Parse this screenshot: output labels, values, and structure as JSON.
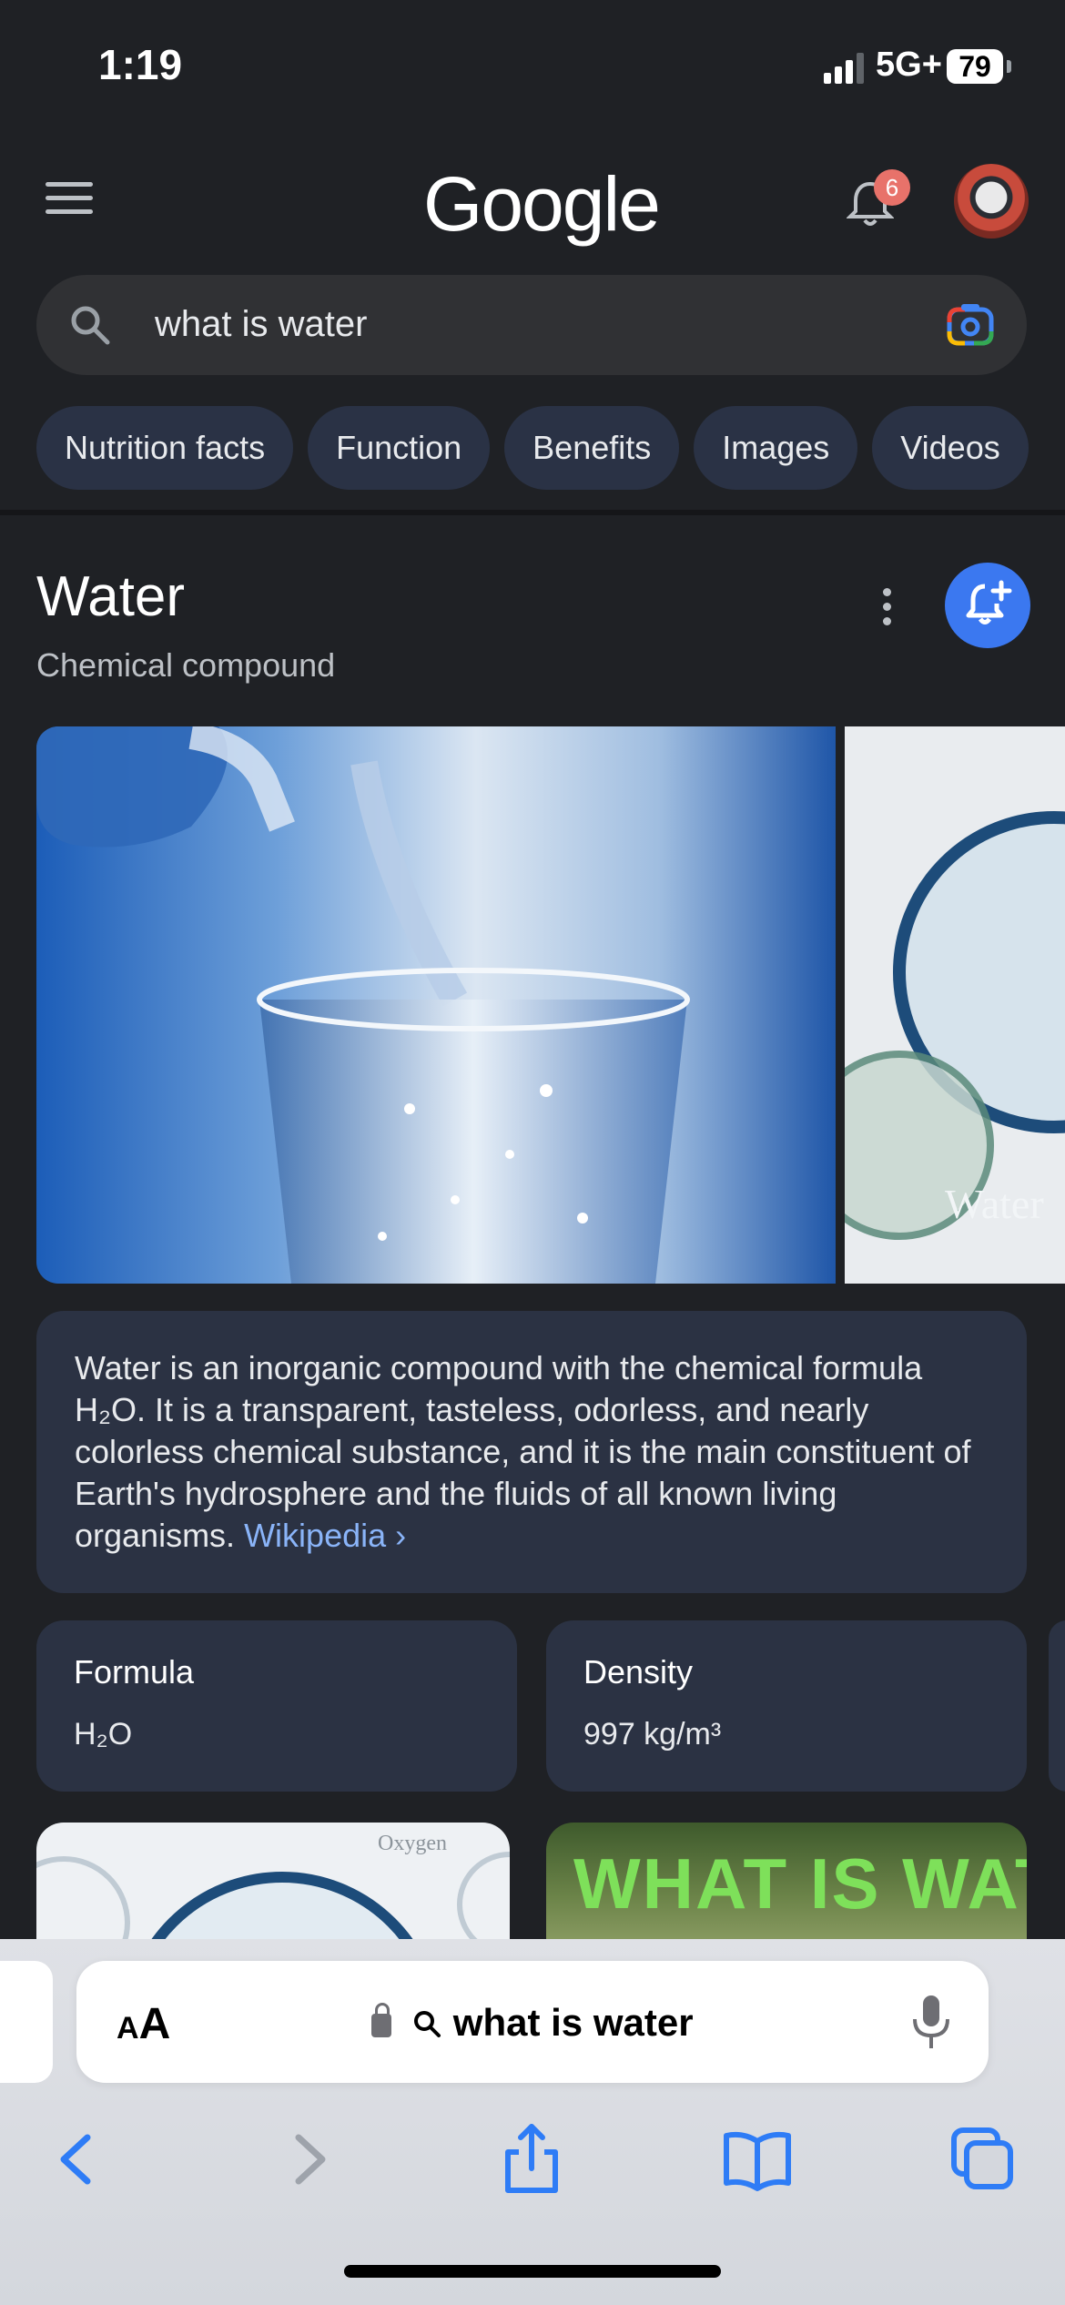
{
  "status_bar": {
    "time": "1:19",
    "network": "5G+",
    "battery": "79"
  },
  "header": {
    "logo": "Google",
    "notification_count": "6"
  },
  "search": {
    "query": "what is water"
  },
  "chips": [
    "Nutrition facts",
    "Function",
    "Benefits",
    "Images",
    "Videos"
  ],
  "entity": {
    "title": "Water",
    "subtitle": "Chemical compound",
    "description": "Water is an inorganic compound with the chemical formula H₂O. It is a transparent, tasteless, odorless, and nearly colorless chemical substance, and it is the main constituent of Earth's hydrosphere and the fluids of all known living organisms.",
    "source_link": "Wikipedia",
    "image_text_side": "Water",
    "facts": [
      {
        "label": "Formula",
        "value": "H₂O"
      },
      {
        "label": "Density",
        "value": "997 kg/m³"
      }
    ],
    "thumbnails": [
      {
        "caption": "Oxygen"
      },
      {
        "caption": "WHAT IS WAT"
      }
    ]
  },
  "safari": {
    "aa_label": "AA",
    "url_text": "what is water"
  },
  "colors": {
    "accent_blue": "#3b78f0",
    "link": "#8ab4f8",
    "background": "#1f2125",
    "card": "#2b3243"
  }
}
